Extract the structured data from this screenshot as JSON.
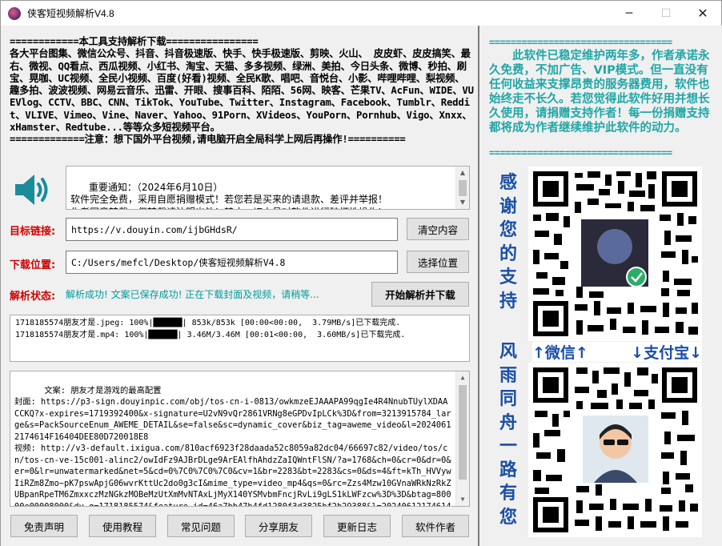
{
  "window": {
    "title": "侠客短视频解析V4.8",
    "minimize": "─",
    "maximize": "☐",
    "close": "✕"
  },
  "notice": {
    "header": "============本工具支持解析下载================",
    "body": "各大平台图集、微信公众号、抖音、抖音极速版、快手、快手极速版、剪映、火山、 皮皮虾、皮皮搞笑、最右、微视、QQ看点、西瓜视频、小红书、淘宝、天猫、多多视频、绿洲、美拍、今日头条、微博、秒拍、刷宝、晃咖、UC视频、全民小视频、百度(好看)视频、全民K歌、唱吧、音悦台、小影、哔哩哔哩、梨视频、趣多拍、波波视频、网易云音乐、迅雷、开眼、搜事百科、陌陌、56网、映客、芒果TV、AcFun、WIDE、VUEVlog、CCTV、BBC、CNN、TikTok、YouTube、Twitter、Instagram、Facebook、Tumblr、Reddit、VLIVE、Vimeo、Vine、Naver、Yahoo、91Porn、XVideos、YouPorn、Pornhub、Vigo、Xnxx、xHamster、Redtube...等等众多短视频平台。",
    "footer": "=============注意：想下国外平台视频,请电脑开启全局科学上网后再操作!=========="
  },
  "important_notice": {
    "text": "重要通知：（2024年6月10日）\n软件完全免费，采用自愿捐赠模式！若您若是买来的请退款、差评并举报！\n作者同意转载，但转载请注明出处！禁止一切人员对软件进行破坏性操作!"
  },
  "target_link": {
    "label": "目标链接:",
    "value": "https://v.douyin.com/ijbGHdsR/",
    "button": "清空内容"
  },
  "download_location": {
    "label": "下载位置:",
    "value": "C:/Users/mefcl/Desktop/侠客短视频解析V4.8",
    "button": "选择位置"
  },
  "parse_status": {
    "label": "解析状态:",
    "value": "解析成功! 文案已保存成功! 正在下载封面及视频，请稍等...",
    "button": "开始解析并下载"
  },
  "progress_lines": [
    "1718185574朋友才是.jpeg: 100%|██████| 853k/853k [00:00<00:00,  3.79MB/s]已下载完成.",
    "1718185574朋友才是.mp4: 100%|██████| 3.46M/3.46M [00:01<00:00,  3.60MB/s]已下载完成."
  ],
  "log": {
    "text": "文案: 朋友才是游戏的最高配置\n封面: https://p3-sign.douyinpic.com/obj/tos-cn-i-0813/owkmzeEJAAAPA99qgIe4R4NnubTUylXDAACCKQ?x-expires=1719392400&x-signature=U2vN9vQr2861VRNg8eGPDvIpLCk%3D&from=3213915784_large&s=PackSourceEnum_AWEME_DETAIL&se=false&sc=dynamic_cover&biz_tag=aweme_video&l=20240612174614F16404DEE80D720018E8\n视频: http://v3-default.ixigua.com/810acf6923f28daada52c8059a82dc04/66697c82/video/tos/cn/tos-cn-ve-15c001-alinc2/owIdFz9AJBrDLge9ArEAlfhAhdzZaIQWntFlSN/?a=1768&ch=0&cr=0&dr=0&er=0&lr=unwatermarked&net=5&cd=0%7C0%7C0%7C0&cv=1&br=2283&bt=2283&cs=0&ds=4&ft=kTh_HVVywIiRZm8Zmo~pK7pswApjG06wvrKttUc2do0g3cI&mime_type=video_mp4&qs=0&rc=Zzs4Mzw10GVnaWRkNzRkZUBpanRpeTM6ZmxxczMzNGkzMOBeMzUtXmMvNTAxLjMyX140YSMvbmFncjRvLi9gLS1kLWFzcw%3D%3D&btag=80000e00008000&dy_q=1718185574&feature_id=46a7bb47b4fd1280f3d3825bf2b29388&l=20240612174614 24DA2E40AC0130546C0E"
  },
  "bottom_buttons": [
    "免责声明",
    "使用教程",
    "常见问题",
    "分享朋友",
    "更新日志",
    "软件作者"
  ],
  "right_panel": {
    "separator": "==================================",
    "message": "此软件已稳定维护两年多，作者承诺永久免费，不加广告、VIP模式。但一直没有任何收益来支撑昂贵的服务器费用，软件也始终走不长久。若您觉得此软件好用并想长久使用，请捐赠支持作者！每一份捐赠支持都将成为作者继续维护此软件的动力。",
    "vertical_top": [
      "感",
      "谢",
      "您",
      "的",
      "支",
      "持"
    ],
    "vertical_bottom": [
      "风",
      "雨",
      "同",
      "舟",
      "一",
      "路",
      "有",
      "您"
    ],
    "wechat_label": "↑微信↑",
    "alipay_label": "↓支付宝↓"
  },
  "colors": {
    "red_label": "#d00000",
    "status_teal": "#009b9b",
    "right_teal": "#20a6a6",
    "vertical_blue": "#1a4fa6",
    "speaker_teal": "#1a8c9a"
  }
}
